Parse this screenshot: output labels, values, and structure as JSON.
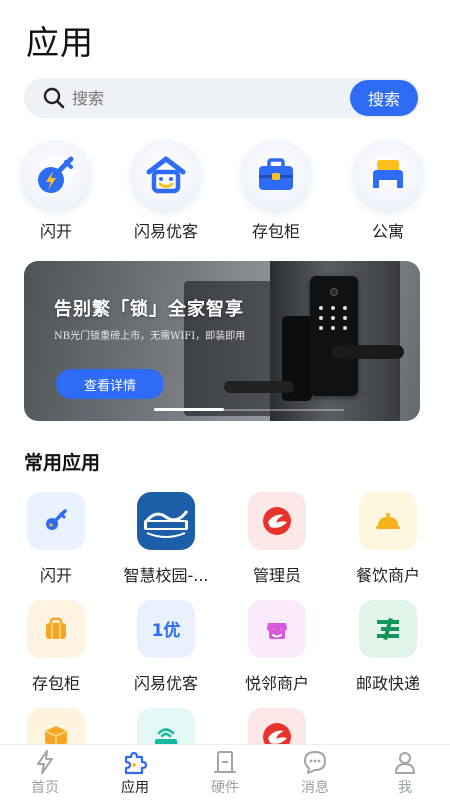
{
  "header": {
    "title": "应用"
  },
  "search": {
    "placeholder": "搜索",
    "button_label": "搜索"
  },
  "quick_actions": [
    {
      "label": "闪开",
      "icon": "lightning-key-icon"
    },
    {
      "label": "闪易优客",
      "icon": "smile-house-icon"
    },
    {
      "label": "存包柜",
      "icon": "briefcase-icon"
    },
    {
      "label": "公寓",
      "icon": "bed-icon"
    }
  ],
  "banner": {
    "title": "告别繁「锁」全家智享",
    "subtitle": "NB光门锁重磅上市，无需WIFI，即装即用",
    "button_label": "查看详情"
  },
  "common_apps": {
    "title": "常用应用",
    "items": [
      {
        "label": "闪开",
        "icon": "key-icon",
        "color": "#eaf1ff"
      },
      {
        "label": "智慧校园-...",
        "icon": "campus-logo-icon",
        "color": "#1c5fa8"
      },
      {
        "label": "管理员",
        "icon": "admin-logo-icon",
        "color": "#fde8e8"
      },
      {
        "label": "餐饮商户",
        "icon": "dish-cover-icon",
        "color": "#fff6e0"
      },
      {
        "label": "存包柜",
        "icon": "bag-icon",
        "color": "#fff4e2"
      },
      {
        "label": "闪易优客",
        "icon": "you-badge-icon",
        "color": "#e9f1ff"
      },
      {
        "label": "悦邻商户",
        "icon": "shop-icon",
        "color": "#fbeafb"
      },
      {
        "label": "邮政快递",
        "icon": "post-logo-icon",
        "color": "#e2f5ea"
      },
      {
        "label": "",
        "icon": "package-icon",
        "color": "#fff4e0"
      },
      {
        "label": "",
        "icon": "router-icon",
        "color": "#e4f8f5"
      },
      {
        "label": "",
        "icon": "admin-logo-icon",
        "color": "#fde8e8"
      }
    ]
  },
  "tabbar": {
    "items": [
      {
        "label": "首页",
        "icon": "lightning-icon",
        "active": false
      },
      {
        "label": "应用",
        "icon": "puzzle-icon",
        "active": true
      },
      {
        "label": "硬件",
        "icon": "door-icon",
        "active": false
      },
      {
        "label": "消息",
        "icon": "chat-icon",
        "active": false
      },
      {
        "label": "我",
        "icon": "user-icon",
        "active": false
      }
    ]
  },
  "colors": {
    "accent": "#2f6cf5",
    "text": "#222222",
    "muted": "#9aa0a6"
  }
}
